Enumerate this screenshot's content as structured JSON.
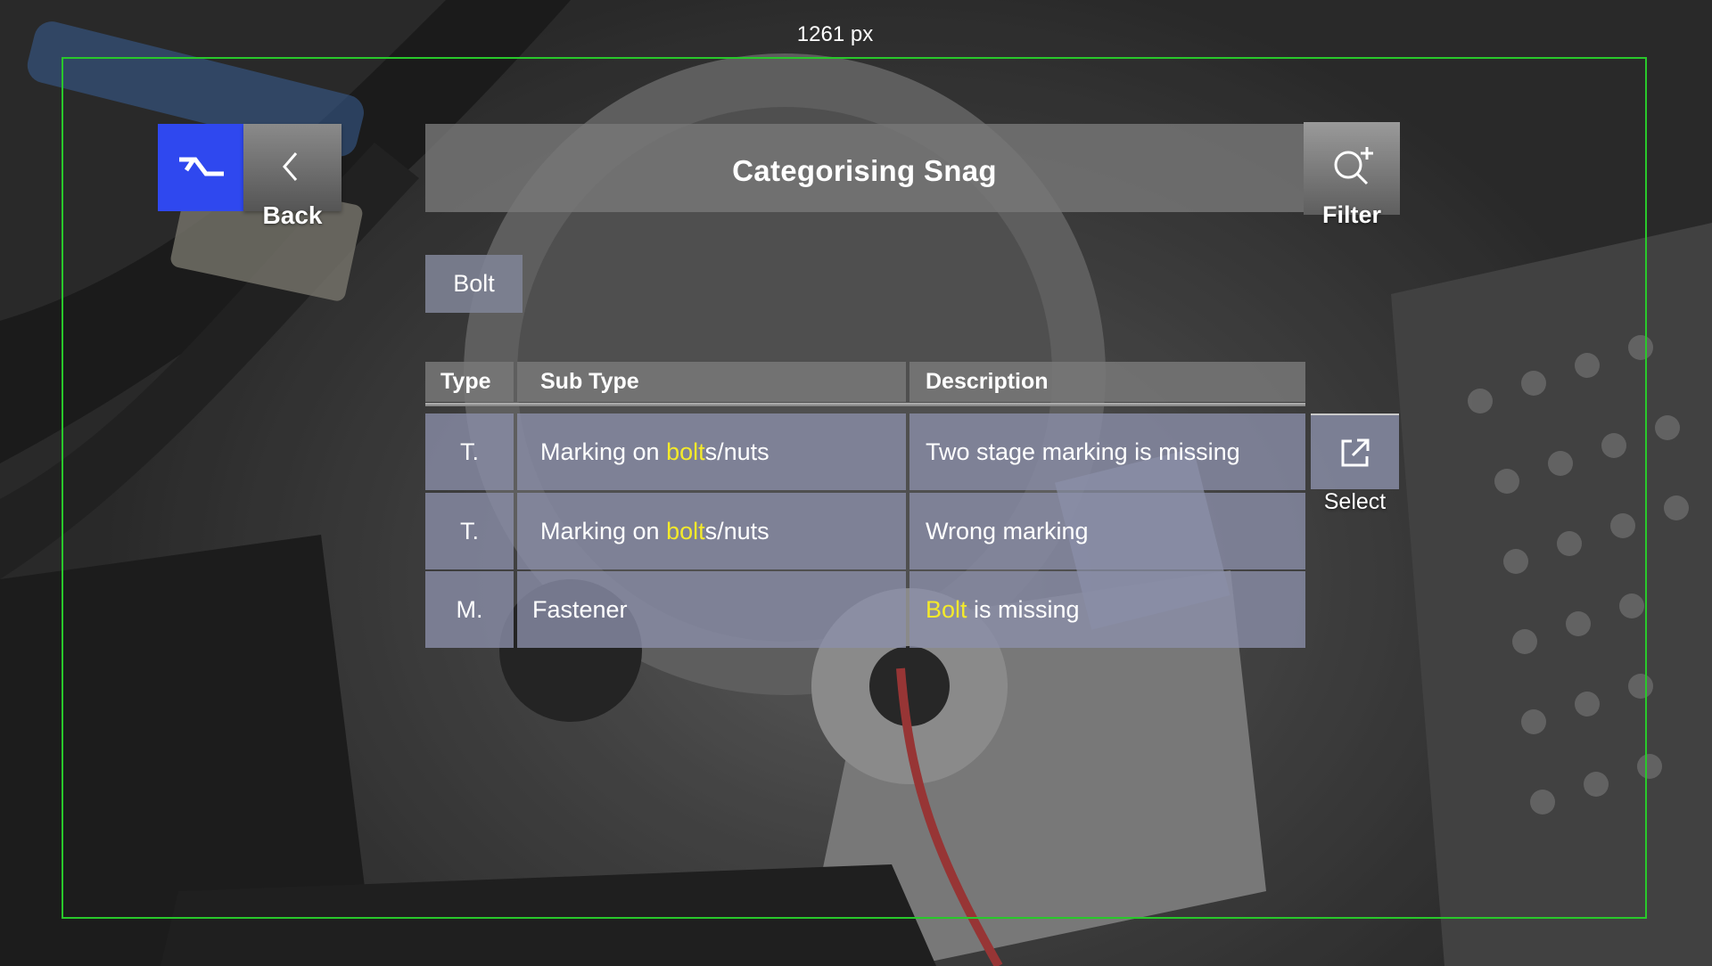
{
  "guide": {
    "label": "1261 px"
  },
  "header": {
    "back_label": "Back",
    "title": "Categorising Snag",
    "filter_label": "Filter"
  },
  "chip": {
    "label": "Bolt"
  },
  "table": {
    "columns": [
      "Type",
      "Sub Type",
      "Description"
    ],
    "rows": [
      {
        "type": "T.",
        "subtype": {
          "before": "Marking on ",
          "highlight": "bolt",
          "after": "s/nuts"
        },
        "description": {
          "before": "",
          "highlight": "",
          "after": "Two stage marking is missing"
        }
      },
      {
        "type": "T.",
        "subtype": {
          "before": "Marking on ",
          "highlight": "bolt",
          "after": "s/nuts"
        },
        "description": {
          "before": "",
          "highlight": "",
          "after": "Wrong marking"
        }
      },
      {
        "type": "M.",
        "subtype": {
          "before": "Fastener",
          "highlight": "",
          "after": ""
        },
        "description": {
          "before": "",
          "highlight": "Bolt",
          "after": " is missing"
        }
      }
    ]
  },
  "select": {
    "label": "Select"
  },
  "colors": {
    "accent_blue": "#2f48ef",
    "highlight_yellow": "#f4ea2a",
    "guide_green": "#29c82b"
  },
  "icons": {
    "logo": "brand-logo-icon",
    "back": "chevron-left-icon",
    "filter": "search-plus-icon",
    "select": "external-link-icon"
  }
}
